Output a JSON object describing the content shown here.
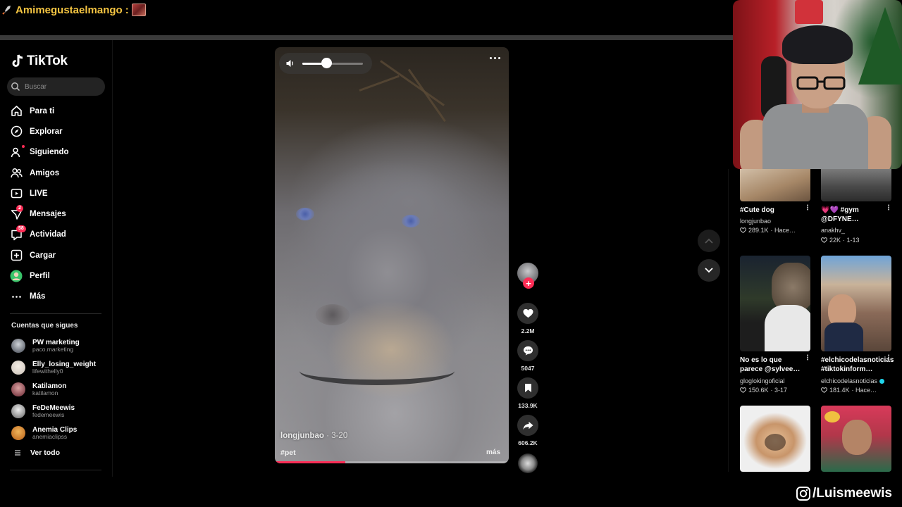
{
  "overlay": {
    "chat_user": "Amimegustaelmango",
    "chat_colon": ":",
    "social_handle": "/Luismeewis"
  },
  "app": {
    "logo_text": "TikTok",
    "search_placeholder": "Buscar"
  },
  "nav": [
    {
      "label": "Para ti",
      "icon": "home-icon"
    },
    {
      "label": "Explorar",
      "icon": "compass-icon"
    },
    {
      "label": "Siguiendo",
      "icon": "following-icon"
    },
    {
      "label": "Amigos",
      "icon": "friends-icon"
    },
    {
      "label": "LIVE",
      "icon": "live-icon"
    },
    {
      "label": "Mensajes",
      "icon": "messages-icon",
      "badge": "2"
    },
    {
      "label": "Actividad",
      "icon": "activity-icon",
      "badge": "58"
    },
    {
      "label": "Cargar",
      "icon": "upload-icon"
    },
    {
      "label": "Perfil",
      "icon": "profile-avatar-icon"
    },
    {
      "label": "Más",
      "icon": "more-icon"
    }
  ],
  "following": {
    "title": "Cuentas que sigues",
    "accounts": [
      {
        "name": "PW marketing",
        "handle": "paco.marketing",
        "color": "#6a6f78"
      },
      {
        "name": "Elly_losing_weight",
        "handle": "lifewithelly0",
        "color": "#d8cfc6"
      },
      {
        "name": "Katilamon",
        "handle": "katilamon",
        "color": "#8a4a52"
      },
      {
        "name": "FeDeMeewis",
        "handle": "fedemeewis",
        "color": "#c9c9c9"
      },
      {
        "name": "Anemia Clips",
        "handle": "anemiaclipss",
        "color": "#c9782a"
      }
    ],
    "see_all": "Ver todo"
  },
  "video": {
    "author": "longjunbao",
    "date": "· 3-20",
    "hashtag": "#pet",
    "more_label": "más",
    "progress": 0.3,
    "volume": 0.4
  },
  "actions": {
    "likes": "2.2M",
    "comments": "5047",
    "saves": "133.9K",
    "shares": "606.2K"
  },
  "grid": [
    {
      "title": "#Cute dog",
      "user": "longjunbao",
      "likes": "289.1K",
      "date": "· Hace…",
      "bg": "#b89a7a"
    },
    {
      "title": "💗💜 #gym @DFYNE…",
      "user": "anakhv_",
      "likes": "22K",
      "date": "· 1-13",
      "bg": "#6b6b6b"
    },
    {
      "title": "No es lo que parece @sylvee…",
      "user": "glogloking​oficial",
      "likes": "150.6K",
      "date": "· 3-17",
      "bg": "#2f3a2a"
    },
    {
      "title": "#elchicodelasnoticias #tiktokinform…",
      "user": "elchicodelasnoticias",
      "likes": "181.4K",
      "date": "· Hace…",
      "bg": "#8a6a58",
      "verified": true
    },
    {
      "title": "",
      "user": "",
      "likes": "",
      "date": "",
      "bg": "#c8956a"
    },
    {
      "title": "",
      "user": "",
      "likes": "",
      "date": "",
      "bg": "#b2374a"
    }
  ],
  "colors": {
    "accent": "#fe2c55",
    "chat_user": "#f5c542",
    "verified": "#20d5ec"
  }
}
